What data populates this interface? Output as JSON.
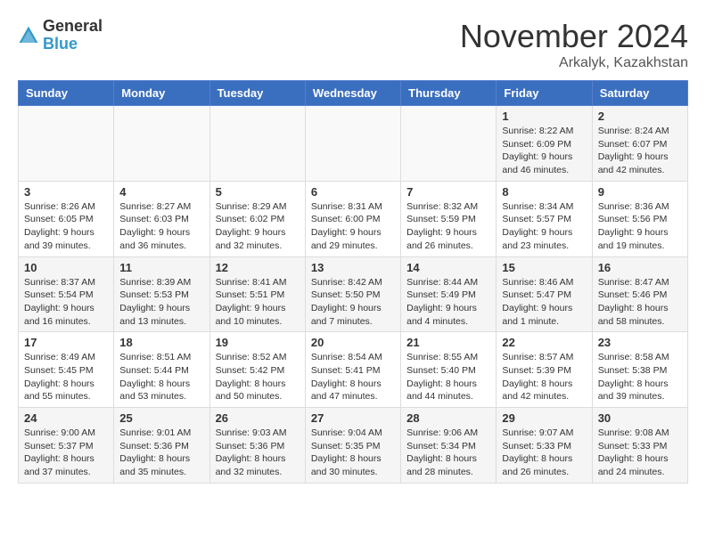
{
  "header": {
    "logo_general": "General",
    "logo_blue": "Blue",
    "month_title": "November 2024",
    "location": "Arkalyk, Kazakhstan"
  },
  "weekdays": [
    "Sunday",
    "Monday",
    "Tuesday",
    "Wednesday",
    "Thursday",
    "Friday",
    "Saturday"
  ],
  "weeks": [
    [
      {
        "day": "",
        "detail": ""
      },
      {
        "day": "",
        "detail": ""
      },
      {
        "day": "",
        "detail": ""
      },
      {
        "day": "",
        "detail": ""
      },
      {
        "day": "",
        "detail": ""
      },
      {
        "day": "1",
        "detail": "Sunrise: 8:22 AM\nSunset: 6:09 PM\nDaylight: 9 hours and 46 minutes."
      },
      {
        "day": "2",
        "detail": "Sunrise: 8:24 AM\nSunset: 6:07 PM\nDaylight: 9 hours and 42 minutes."
      }
    ],
    [
      {
        "day": "3",
        "detail": "Sunrise: 8:26 AM\nSunset: 6:05 PM\nDaylight: 9 hours and 39 minutes."
      },
      {
        "day": "4",
        "detail": "Sunrise: 8:27 AM\nSunset: 6:03 PM\nDaylight: 9 hours and 36 minutes."
      },
      {
        "day": "5",
        "detail": "Sunrise: 8:29 AM\nSunset: 6:02 PM\nDaylight: 9 hours and 32 minutes."
      },
      {
        "day": "6",
        "detail": "Sunrise: 8:31 AM\nSunset: 6:00 PM\nDaylight: 9 hours and 29 minutes."
      },
      {
        "day": "7",
        "detail": "Sunrise: 8:32 AM\nSunset: 5:59 PM\nDaylight: 9 hours and 26 minutes."
      },
      {
        "day": "8",
        "detail": "Sunrise: 8:34 AM\nSunset: 5:57 PM\nDaylight: 9 hours and 23 minutes."
      },
      {
        "day": "9",
        "detail": "Sunrise: 8:36 AM\nSunset: 5:56 PM\nDaylight: 9 hours and 19 minutes."
      }
    ],
    [
      {
        "day": "10",
        "detail": "Sunrise: 8:37 AM\nSunset: 5:54 PM\nDaylight: 9 hours and 16 minutes."
      },
      {
        "day": "11",
        "detail": "Sunrise: 8:39 AM\nSunset: 5:53 PM\nDaylight: 9 hours and 13 minutes."
      },
      {
        "day": "12",
        "detail": "Sunrise: 8:41 AM\nSunset: 5:51 PM\nDaylight: 9 hours and 10 minutes."
      },
      {
        "day": "13",
        "detail": "Sunrise: 8:42 AM\nSunset: 5:50 PM\nDaylight: 9 hours and 7 minutes."
      },
      {
        "day": "14",
        "detail": "Sunrise: 8:44 AM\nSunset: 5:49 PM\nDaylight: 9 hours and 4 minutes."
      },
      {
        "day": "15",
        "detail": "Sunrise: 8:46 AM\nSunset: 5:47 PM\nDaylight: 9 hours and 1 minute."
      },
      {
        "day": "16",
        "detail": "Sunrise: 8:47 AM\nSunset: 5:46 PM\nDaylight: 8 hours and 58 minutes."
      }
    ],
    [
      {
        "day": "17",
        "detail": "Sunrise: 8:49 AM\nSunset: 5:45 PM\nDaylight: 8 hours and 55 minutes."
      },
      {
        "day": "18",
        "detail": "Sunrise: 8:51 AM\nSunset: 5:44 PM\nDaylight: 8 hours and 53 minutes."
      },
      {
        "day": "19",
        "detail": "Sunrise: 8:52 AM\nSunset: 5:42 PM\nDaylight: 8 hours and 50 minutes."
      },
      {
        "day": "20",
        "detail": "Sunrise: 8:54 AM\nSunset: 5:41 PM\nDaylight: 8 hours and 47 minutes."
      },
      {
        "day": "21",
        "detail": "Sunrise: 8:55 AM\nSunset: 5:40 PM\nDaylight: 8 hours and 44 minutes."
      },
      {
        "day": "22",
        "detail": "Sunrise: 8:57 AM\nSunset: 5:39 PM\nDaylight: 8 hours and 42 minutes."
      },
      {
        "day": "23",
        "detail": "Sunrise: 8:58 AM\nSunset: 5:38 PM\nDaylight: 8 hours and 39 minutes."
      }
    ],
    [
      {
        "day": "24",
        "detail": "Sunrise: 9:00 AM\nSunset: 5:37 PM\nDaylight: 8 hours and 37 minutes."
      },
      {
        "day": "25",
        "detail": "Sunrise: 9:01 AM\nSunset: 5:36 PM\nDaylight: 8 hours and 35 minutes."
      },
      {
        "day": "26",
        "detail": "Sunrise: 9:03 AM\nSunset: 5:36 PM\nDaylight: 8 hours and 32 minutes."
      },
      {
        "day": "27",
        "detail": "Sunrise: 9:04 AM\nSunset: 5:35 PM\nDaylight: 8 hours and 30 minutes."
      },
      {
        "day": "28",
        "detail": "Sunrise: 9:06 AM\nSunset: 5:34 PM\nDaylight: 8 hours and 28 minutes."
      },
      {
        "day": "29",
        "detail": "Sunrise: 9:07 AM\nSunset: 5:33 PM\nDaylight: 8 hours and 26 minutes."
      },
      {
        "day": "30",
        "detail": "Sunrise: 9:08 AM\nSunset: 5:33 PM\nDaylight: 8 hours and 24 minutes."
      }
    ]
  ]
}
